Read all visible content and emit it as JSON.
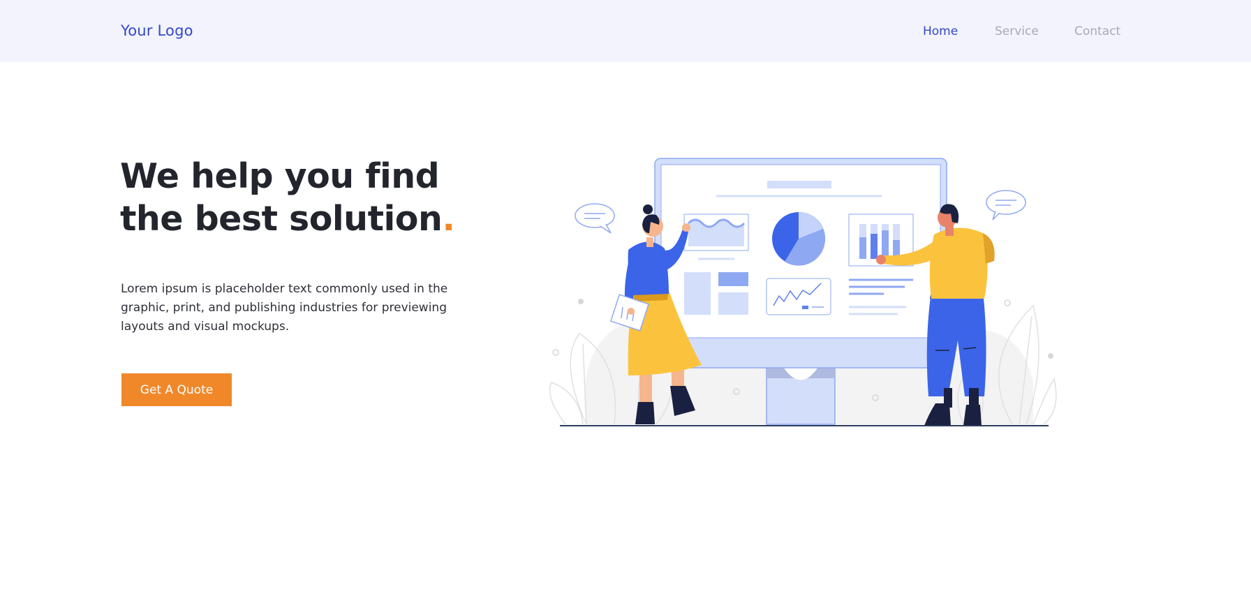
{
  "header": {
    "logo": "Your Logo",
    "nav": [
      {
        "label": "Home",
        "active": true
      },
      {
        "label": "Service",
        "active": false
      },
      {
        "label": "Contact",
        "active": false
      }
    ]
  },
  "hero": {
    "headline_line1": "We help you find",
    "headline_line2": "the best solution",
    "headline_dot": ".",
    "description": "Lorem ipsum is placeholder text commonly used in the graphic, print, and publishing industries for previewing layouts and visual mockups.",
    "cta_label": "Get A Quote"
  },
  "colors": {
    "accent": "#f0882a",
    "brand": "#3447c8",
    "nav_background": "#f2f3fd",
    "heading": "#23252c"
  }
}
